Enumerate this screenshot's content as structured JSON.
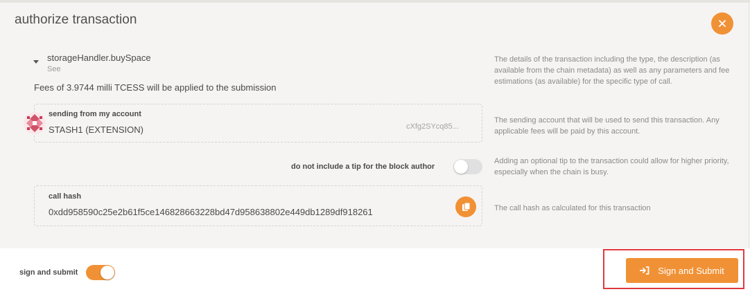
{
  "modal": {
    "title": "authorize transaction"
  },
  "transaction": {
    "method": "storageHandler.buySpace",
    "method_sub": "See",
    "fees_text": "Fees of 3.9744 milli TCESS will be applied to the submission"
  },
  "account": {
    "label": "sending from my account",
    "name": "STASH1 (EXTENSION)",
    "address": "cXfg2SYcq85..."
  },
  "tip": {
    "label": "do not include a tip for the block author",
    "enabled": false
  },
  "call_hash": {
    "label": "call hash",
    "value": "0xdd958590c25e2b61f5ce146828663228bd47d958638802e449db1289df918261"
  },
  "help": {
    "details": "The details of the transaction including the type, the description (as available from the chain metadata) as well as any parameters and fee estimations (as available) for the specific type of call.",
    "sending": "The sending account that will be used to send this transaction. Any applicable fees will be paid by this account.",
    "tip": "Adding an optional tip to the transaction could allow for higher priority, especially when the chain is busy.",
    "hash": "The call hash as calculated for this transaction"
  },
  "footer": {
    "sign_label": "sign and submit",
    "sign_enabled": true,
    "submit_label": "Sign and Submit"
  },
  "colors": {
    "accent": "#f19135",
    "highlight_border": "#e0393e"
  },
  "icons": {
    "close": "close-icon",
    "copy": "copy-icon",
    "submit": "sign-in-icon",
    "expand": "caret-down-icon",
    "avatar": "identicon"
  }
}
